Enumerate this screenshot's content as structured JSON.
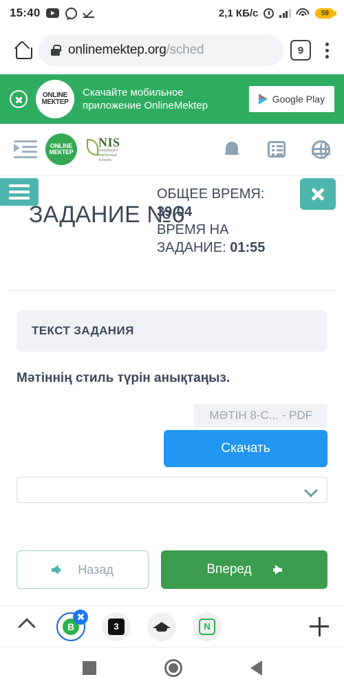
{
  "status_bar": {
    "time": "15:40",
    "icons_left": [
      "youtube-icon",
      "whatsapp-icon",
      "download-done-icon"
    ],
    "network_speed": "2,1 КБ/с",
    "icons_right": [
      "alarm-icon",
      "signal-icon",
      "wifi-icon"
    ],
    "battery_level": "59"
  },
  "browser": {
    "home_icon": "home-icon",
    "lock_icon": "lock-icon",
    "url_domain": "onlinemektep.org",
    "url_path": "/sched",
    "tab_count": "9",
    "menu_icon": "kebab-menu-icon"
  },
  "promo": {
    "close_icon": "close-circle-icon",
    "logo_line1": "ONLINE",
    "logo_line2": "МЕКТЕР",
    "text_line1": "Скачайте мобильное",
    "text_line2": "приложение OnlineMektep",
    "store_button": "Google Play",
    "background_color": "#2eac5f"
  },
  "site_nav": {
    "menu_icon": "menu-indent-icon",
    "logo_line1": "ONLINE",
    "logo_line2": "МЕКТЕР",
    "nis_abbr": "NIS",
    "nis_sub1": "Nazarbayev",
    "nis_sub2": "Intellectual",
    "nis_sub3": "Schools",
    "icons": [
      "bell-icon",
      "list-icon",
      "globe-icon"
    ]
  },
  "task_header": {
    "burger_icon": "hamburger-menu-icon",
    "close_icon": "close-icon",
    "title": "ЗАДАНИЕ №6",
    "total_time_label": "ОБЩЕЕ ВРЕМЯ:",
    "total_time_value": "39:04",
    "task_time_label_line1": "ВРЕМЯ НА",
    "task_time_label_line2": "ЗАДАНИЕ:",
    "task_time_value": "01:55",
    "accent_color": "#4db6ac"
  },
  "main": {
    "card_title": "ТЕКСТ ЗАДАНИЯ",
    "question": "Мәтіннің стиль түрін анықтаңыз.",
    "file_chip": "МӘТІН 8-С... - PDF",
    "download_button": "Скачать",
    "download_button_color": "#2196f3",
    "answer_select_value": "",
    "answer_select_chevron": "chevron-down-icon",
    "back_button": "Назад",
    "forward_button": "Вперед",
    "forward_button_color": "#3b9c4e"
  },
  "dock": {
    "expand_icon": "chevron-up-icon",
    "apps": [
      {
        "name": "app-b",
        "glyph": "B",
        "active": true,
        "close_badge": "close-badge-icon"
      },
      {
        "name": "app-3",
        "glyph": "3",
        "active": false
      },
      {
        "name": "app-graduation",
        "glyph": "",
        "active": false
      },
      {
        "name": "app-n",
        "glyph": "N",
        "active": false
      }
    ],
    "add_icon": "plus-icon"
  },
  "android_nav": {
    "recents_icon": "square-recents-icon",
    "home_icon": "circle-home-icon",
    "back_icon": "triangle-back-icon"
  }
}
